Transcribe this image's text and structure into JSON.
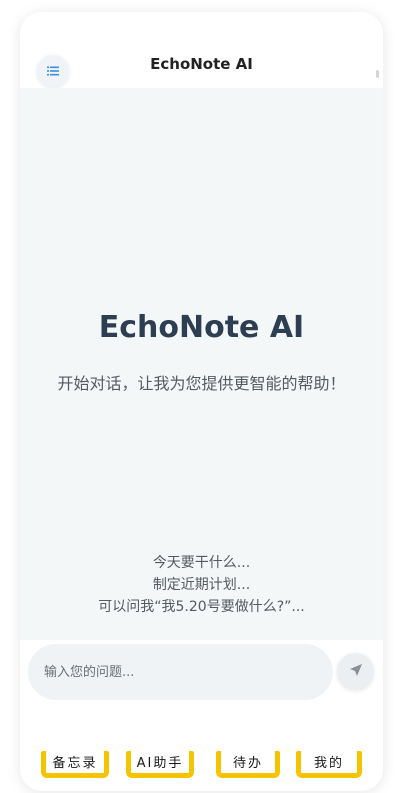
{
  "header": {
    "title": "EchoNote AI",
    "menu_icon": "list-menu-icon"
  },
  "hero": {
    "title": "EchoNote AI",
    "subtitle": "开始对话，让我为您提供更智能的帮助！"
  },
  "suggestions": [
    "今天要干什么...",
    "制定近期计划...",
    "可以问我“我5.20号要做什么?”..."
  ],
  "input": {
    "placeholder": "输入您的问题...",
    "value": "",
    "send_icon": "send-icon"
  },
  "tabs": [
    {
      "label": "备忘录"
    },
    {
      "label": "AI助手"
    },
    {
      "label": "待办"
    },
    {
      "label": "我的"
    }
  ],
  "colors": {
    "highlight": "#f5c400",
    "accent": "#3a8ee6",
    "title": "#2e3e52"
  }
}
